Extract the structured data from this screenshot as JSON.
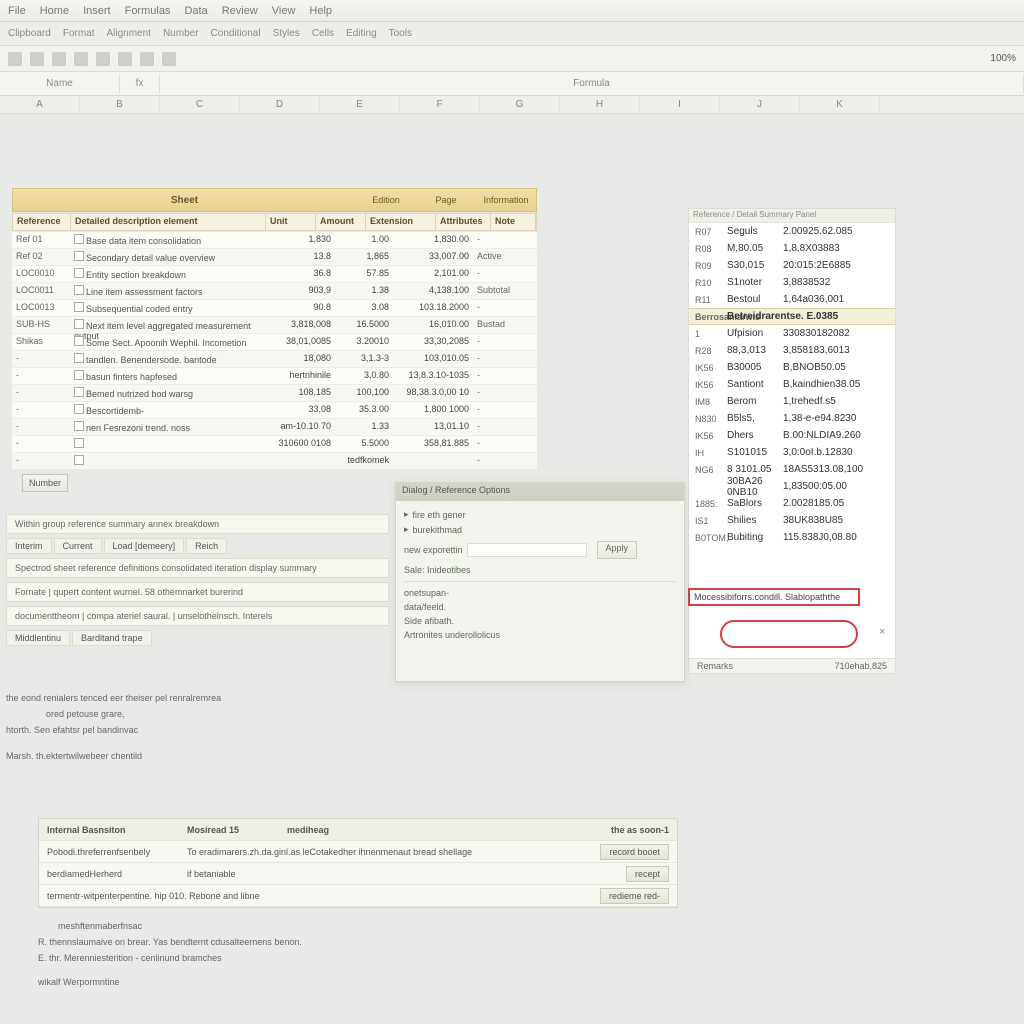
{
  "menubar": {
    "items": [
      "File",
      "Home",
      "Insert",
      "Formulas",
      "Data",
      "Review",
      "View",
      "Help"
    ]
  },
  "ribbon": {
    "items": [
      "Clipboard",
      "Format",
      "Alignment",
      "Number",
      "Conditional",
      "Styles",
      "Cells",
      "Editing",
      "Tools"
    ]
  },
  "toolbar": {
    "save": "Save",
    "undo": "Undo",
    "redo": "Redo",
    "zoom": "100%"
  },
  "headerbar": {
    "a": "Name",
    "b": "",
    "c": "Formula"
  },
  "cols": [
    "A",
    "B",
    "C",
    "D",
    "E",
    "F",
    "G",
    "H",
    "I",
    "J",
    "K"
  ],
  "yellow": {
    "main": "Sheet",
    "sub1": "Edition",
    "sub2": "Page",
    "sub3": "Information"
  },
  "tablehdr": {
    "c1": "Reference",
    "c2": "Detailed description element",
    "c3": "Unit",
    "c4": "Amount",
    "c5": "Extension",
    "c6": "Attributes",
    "c7": "Note"
  },
  "leftrows": [
    {
      "c1": "Ref 01",
      "c2": "Base data item consolidation",
      "c3": "1,830",
      "c4": "1.00",
      "c5": "1,830.00",
      "c6": "-"
    },
    {
      "c1": "Ref 02",
      "c2": "Secondary detail value overview",
      "c3": "13.8",
      "c4": "1,865",
      "c5": "33,007.00",
      "c6": "Active"
    },
    {
      "c1": "LOC0010",
      "c2": "Entity section breakdown",
      "c3": "36.8",
      "c4": "57.85",
      "c5": "2,101.00",
      "c6": "-"
    },
    {
      "c1": "LOC0011",
      "c2": "Line item assessment factors",
      "c3": "903.9",
      "c4": "1.38",
      "c5": "4,138.100",
      "c6": "Subtotal"
    },
    {
      "c1": "LOC0013",
      "c2": "Subsequential coded entry",
      "c3": "90.8",
      "c4": "3.08",
      "c5": "103.18.2000",
      "c6": "-"
    },
    {
      "c1": "SUB-HS",
      "c2": "Next item level aggregated measurement output",
      "c3": "3,818,008",
      "c4": "16.5000",
      "c5": "16,010.00",
      "c6": "Bustad"
    },
    {
      "c1": "Shikas",
      "c2": "Some Sect. Apoonih Wephil. Incometion",
      "c3": "38,01,0085",
      "c4": "3.20010",
      "c5": "33,30,2085",
      "c6": "-"
    },
    {
      "c1": "-",
      "c2": "tandlen. Benendersode. bantode",
      "c3": "18,080",
      "c4": "3,1.3-3",
      "c5": "103,010.05",
      "c6": "-"
    },
    {
      "c1": "-",
      "c2": "basun finters hapfesed",
      "c3": "hertrihinile",
      "c4": "3,0.80",
      "c5": "13,8.3.10-1035",
      "c6": "-"
    },
    {
      "c1": "-",
      "c2": "Bemed nutrized bod warsg",
      "c3": "108,185",
      "c4": "100,100",
      "c5": "98,38.3.0,00 10",
      "c6": "-"
    },
    {
      "c1": "-",
      "c2": "Bescortidemb-",
      "c3": "33,08",
      "c4": "35.3.00",
      "c5": "1,800 1000",
      "c6": "-"
    },
    {
      "c1": "-",
      "c2": "nen Fesrezoni trend. noss",
      "c3": "am-10.10 70",
      "c4": "1.33",
      "c5": "13,01.10",
      "c6": "-"
    },
    {
      "c1": "-",
      "c2": "",
      "c3": "310600 0108",
      "c4": "5.5000",
      "c5": "358,81.885",
      "c6": "-"
    },
    {
      "c1": "-",
      "c2": "",
      "c3": "",
      "c4": "tedfkomek",
      "c5": "",
      "c6": "-"
    }
  ],
  "btn1": "Number",
  "rightpanel": {
    "header": "Reference / Detail Summary Panel",
    "rows": [
      {
        "c1": "R07",
        "c2": "Seguls",
        "c3": "2.00925.62.085"
      },
      {
        "c1": "R08",
        "c2": "M,80.05",
        "c3": "1,8,8X03883"
      },
      {
        "c1": "R09",
        "c2": "S30,015",
        "c3": "20:015:2E6885"
      },
      {
        "c1": "R10",
        "c2": "S1noter",
        "c3": "3,8838532"
      },
      {
        "c1": "R11",
        "c2": "Bestoul",
        "c3": "1,64a036,001"
      }
    ],
    "hl": {
      "c1": "Berrosanlarwis",
      "c2": "",
      "c3": "Betreidrarentse. E.0385"
    },
    "rows2": [
      {
        "c1": "1",
        "c2": "Ufpision",
        "c3": "330830182082"
      },
      {
        "c1": "R28",
        "c2": "88,3,013",
        "c3": "3,858183,6013"
      },
      {
        "c1": "IK56",
        "c2": "B30005",
        "c3": "B,BNOB50.05"
      },
      {
        "c1": "IK56",
        "c2": "Santiont",
        "c3": "B,kaindhien38.05"
      },
      {
        "c1": "IM8",
        "c2": "Berom",
        "c3": "1,trehedf.s5"
      },
      {
        "c1": "N830",
        "c2": "B5ls5,",
        "c3": "1,38-e-e94.8230"
      },
      {
        "c1": "IK56",
        "c2": "Dhers",
        "c3": "B.00:NLDIA9.260"
      },
      {
        "c1": "IH",
        "c2": "S101015",
        "c3": "3,0:0oI.b.12830"
      },
      {
        "c1": "NG6",
        "c2": "8 3101.05",
        "c3": "18AS5313.08,100"
      },
      {
        "c1": "",
        "c2": "30BA26 0NB10",
        "c3": "1,83500:05.00"
      },
      {
        "c1": "1885:",
        "c2": "SaBlors",
        "c3": "2.0028185.05"
      },
      {
        "c1": "IS1",
        "c2": "Shilies",
        "c3": "38UK838U85"
      },
      {
        "c1": "B0TOM,",
        "c2": "Bubiting",
        "c3": "115.838J0,08.80"
      }
    ],
    "redbox": "Mocessibiforrs.condill. Slablopaththe",
    "foot_l": "Remarks",
    "foot_r": "710ehab,825"
  },
  "dialog": {
    "title": "Dialog / Reference Options",
    "line1": "fire eth gener",
    "line2": "burekithmad",
    "input_label": "new exporettin",
    "btn": "Apply",
    "sub": "Sale: Inideotibes",
    "f1": "onetsupan-",
    "f2": "data/feeld.",
    "f3": "Side afibath.",
    "f4": "Artronites underollolicus"
  },
  "form": {
    "sect1": "Within group reference summary annex breakdown",
    "tabs": [
      "Interim",
      "Current",
      "Load [demeery]",
      "Reich"
    ],
    "row1": "Spectrod sheet reference definitions consolidated iteration display summary",
    "row2": "Fornate | qupert content wurnel. 58 othemnarket burerind",
    "row3": "documenttheom | compa ateriel saural. | unselothelnsch. Interels",
    "tab2": [
      "Middlentinu",
      "Barditand trape"
    ]
  },
  "bottom": {
    "line1": "the eond renialers tenced eer theiser pel renralremrea",
    "line2": "ored petouse grare,",
    "line3": "htorth. Sen efahtsr pel bandinvac",
    "line4": "Marsh. th.ektertwilwebeer chentild",
    "tablehdr": {
      "c1": "Internal Basnsiton",
      "c2": "Mosiread 15",
      "c3": "mediheag",
      "c4": "the as soon-1"
    },
    "tr1": {
      "c1": "Pobodi.threferrenfsenbely",
      "c2": "To eradimarers.zh.da.ginl.as leCotakedher ihnenmenaut bread shellage",
      "btn": "record booet"
    },
    "tr2": {
      "c1": "berdiamedHerherd",
      "c2": "if betaniable",
      "btn": "recept"
    },
    "tr3": {
      "c1": "termentr-witpenterpentine. hip 010. Rebone and libne",
      "btn": "redieme red-"
    },
    "lineA": "meshftenmaberfnsac",
    "lineB": "R. thennslaumaive on brear. Yas bendternt cdusalteernens benon.",
    "lineC": "E. thr. Merenniesterition - cenlinund bramches",
    "lineD": "wikalf Werpormntine"
  }
}
